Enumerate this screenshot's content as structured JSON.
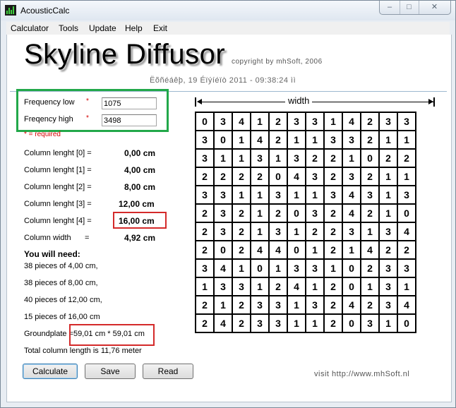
{
  "window": {
    "title": "AcousticCalc",
    "controls": [
      "minimize-icon",
      "maximize-icon",
      "close-icon"
    ]
  },
  "menu": [
    {
      "label": "Calculator"
    },
    {
      "label": "Tools"
    },
    {
      "label": "Update"
    },
    {
      "label": "Help"
    },
    {
      "label": "Exit"
    }
  ],
  "header": {
    "title": "Skyline Diffusor",
    "copyright": "copyright by mhSoft, 2006",
    "datetime": "Ëõñéáêþ, 19 Éïýíéïò 2011 - 09:38:24 ìì"
  },
  "inputs": {
    "freq_low": {
      "label": "Frequency low",
      "value": "1075"
    },
    "freq_high": {
      "label": "Freqency high",
      "value": "3498"
    },
    "required_marker": "*",
    "required_note": "* = required"
  },
  "columns": [
    {
      "label": "Column lenght [0] =",
      "value": "0,00 cm"
    },
    {
      "label": "Column lenght [1] =",
      "value": "4,00 cm"
    },
    {
      "label": "Column lenght [2] =",
      "value": "8,00 cm"
    },
    {
      "label": "Column lenght [3] =",
      "value": "12,00 cm"
    },
    {
      "label": "Column lenght [4] =",
      "value": "16,00 cm"
    }
  ],
  "column_width": {
    "label": "Column width",
    "equals": "=",
    "value": "4,92 cm"
  },
  "need": {
    "heading": "You will need:",
    "items": [
      "38 pieces of  4,00 cm,",
      "38 pieces of  8,00 cm,",
      "40 pieces of  12,00 cm,",
      "15 pieces of  16,00 cm"
    ],
    "groundplate_label": "Groundplate =",
    "groundplate_value": "59,01 cm * 59,01 cm",
    "total": "Total column length is 11,76 meter"
  },
  "buttons": {
    "calculate": "Calculate",
    "save": "Save",
    "read": "Read"
  },
  "visit": "visit http://www.mhSoft.nl",
  "grid_header": "width",
  "grid": [
    [
      0,
      3,
      4,
      1,
      2,
      3,
      3,
      1,
      4,
      2,
      3,
      3
    ],
    [
      3,
      0,
      1,
      4,
      2,
      1,
      1,
      3,
      3,
      2,
      1,
      1
    ],
    [
      3,
      1,
      1,
      3,
      1,
      3,
      2,
      2,
      1,
      0,
      2,
      2
    ],
    [
      2,
      2,
      2,
      2,
      0,
      4,
      3,
      2,
      3,
      2,
      1,
      1
    ],
    [
      3,
      3,
      1,
      1,
      3,
      1,
      1,
      3,
      4,
      3,
      1,
      3
    ],
    [
      2,
      3,
      2,
      1,
      2,
      0,
      3,
      2,
      4,
      2,
      1,
      0
    ],
    [
      2,
      3,
      2,
      1,
      3,
      1,
      2,
      2,
      3,
      1,
      3,
      4
    ],
    [
      2,
      0,
      2,
      4,
      4,
      0,
      1,
      2,
      1,
      4,
      2,
      2
    ],
    [
      3,
      4,
      1,
      0,
      1,
      3,
      3,
      1,
      0,
      2,
      3,
      3
    ],
    [
      1,
      3,
      3,
      1,
      2,
      4,
      1,
      2,
      0,
      1,
      3,
      1
    ],
    [
      2,
      1,
      2,
      3,
      3,
      1,
      3,
      2,
      4,
      2,
      3,
      4
    ],
    [
      2,
      4,
      2,
      3,
      3,
      1,
      1,
      2,
      0,
      3,
      1,
      0
    ]
  ],
  "colors": {
    "highlight_green": "#22a84a",
    "highlight_red": "#d42a2a",
    "required_red": "#d40000"
  }
}
